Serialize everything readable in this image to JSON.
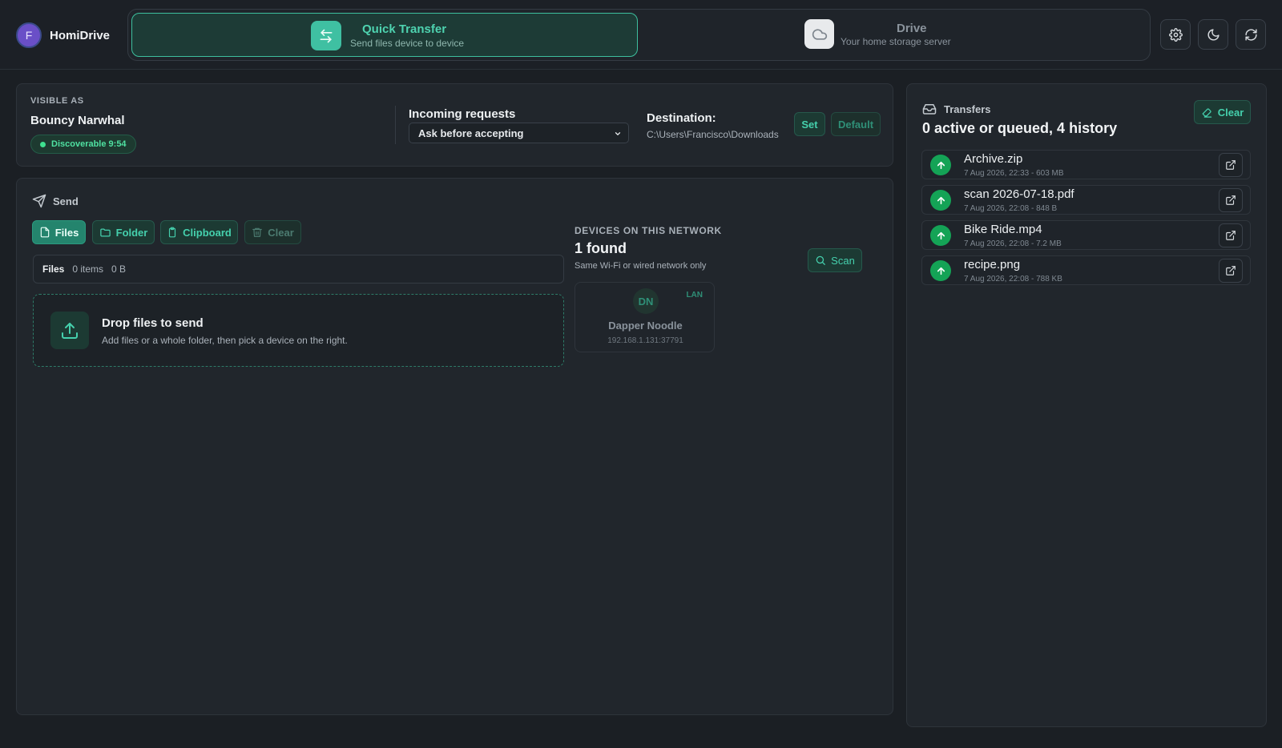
{
  "app": {
    "avatar_letter": "F",
    "name": "HomiDrive"
  },
  "modes": {
    "quick_transfer": {
      "title": "Quick Transfer",
      "subtitle": "Send files device to device"
    },
    "drive": {
      "title": "Drive",
      "subtitle": "Your home storage server"
    }
  },
  "toolbar_icons": [
    "gear-icon",
    "moon-icon",
    "refresh-icon"
  ],
  "identity": {
    "visible_as_label": "VISIBLE AS",
    "device_name": "Bouncy Narwhal",
    "discoverable_badge": "Discoverable 9:54",
    "incoming_label": "Incoming requests",
    "incoming_value": "Ask before accepting",
    "destination_label": "Destination:",
    "destination_path": "C:\\Users\\Francisco\\Downloads",
    "set_label": "Set",
    "default_label": "Default"
  },
  "send": {
    "title": "Send",
    "buttons": {
      "files": "Files",
      "folder": "Folder",
      "clipboard": "Clipboard",
      "clear": "Clear"
    },
    "files_bar": {
      "label": "Files",
      "count": "0 items",
      "size": "0 B"
    },
    "drop": {
      "title": "Drop files to send",
      "subtitle": "Add files or a whole folder, then pick a device on the right."
    }
  },
  "devices": {
    "section_label": "DEVICES ON THIS NETWORK",
    "count": "1 found",
    "note": "Same Wi-Fi or wired network only",
    "scan_label": "Scan",
    "items": [
      {
        "initials": "DN",
        "tag": "LAN",
        "name": "Dapper Noodle",
        "address": "192.168.1.131:37791"
      }
    ]
  },
  "transfers": {
    "title": "Transfers",
    "clear_label": "Clear",
    "summary": "0 active or queued, 4 history",
    "items": [
      {
        "name": "Archive.zip",
        "meta": "7 Aug 2026, 22:33 - 603 MB"
      },
      {
        "name": "scan 2026-07-18.pdf",
        "meta": "7 Aug 2026, 22:08 - 848 B"
      },
      {
        "name": "Bike Ride.mp4",
        "meta": "7 Aug 2026, 22:08 - 7.2 MB"
      },
      {
        "name": "recipe.png",
        "meta": "7 Aug 2026, 22:08 - 788 KB"
      }
    ]
  },
  "colors": {
    "accent": "#45d0ad",
    "background": "#1b1f24",
    "panel": "#21262c",
    "success": "#14a356"
  }
}
